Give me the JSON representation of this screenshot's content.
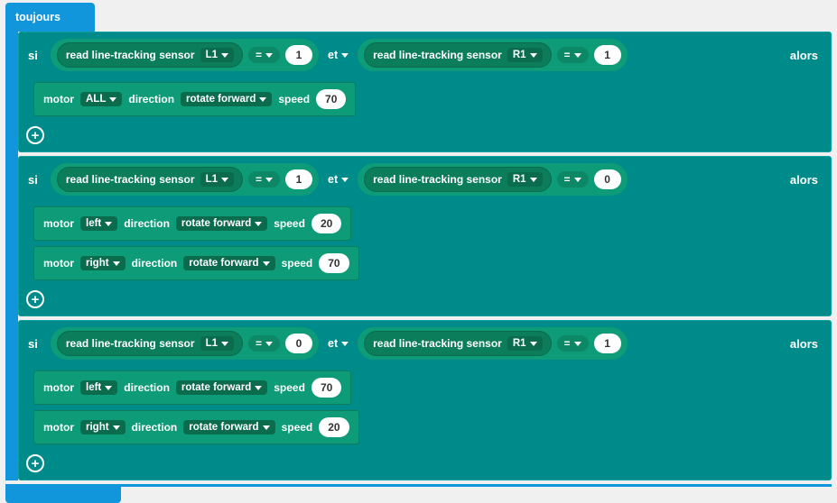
{
  "forever": {
    "label": "toujours"
  },
  "keywords": {
    "if": "si",
    "then": "alors",
    "and": "et"
  },
  "op_eq": "=",
  "sensor": {
    "label": "read line-tracking sensor",
    "L1": "L1",
    "R1": "R1"
  },
  "motor": {
    "prefix": "motor",
    "dir_label": "direction",
    "speed_label": "speed",
    "all": "ALL",
    "left": "left",
    "right": "right",
    "forward": "rotate forward"
  },
  "blocks": [
    {
      "cond": {
        "l_sensor": "L1",
        "l_val": "1",
        "r_sensor": "R1",
        "r_val": "1"
      },
      "actions": [
        {
          "which": "ALL",
          "dir": "rotate forward",
          "speed": "70"
        }
      ]
    },
    {
      "cond": {
        "l_sensor": "L1",
        "l_val": "1",
        "r_sensor": "R1",
        "r_val": "0"
      },
      "actions": [
        {
          "which": "left",
          "dir": "rotate forward",
          "speed": "20"
        },
        {
          "which": "right",
          "dir": "rotate forward",
          "speed": "70"
        }
      ]
    },
    {
      "cond": {
        "l_sensor": "L1",
        "l_val": "0",
        "r_sensor": "R1",
        "r_val": "1"
      },
      "actions": [
        {
          "which": "left",
          "dir": "rotate forward",
          "speed": "70"
        },
        {
          "which": "right",
          "dir": "rotate forward",
          "speed": "20"
        }
      ]
    }
  ]
}
